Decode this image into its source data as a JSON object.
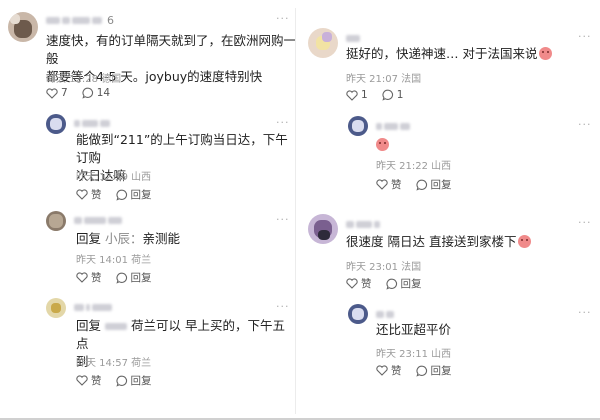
{
  "left": {
    "c1": {
      "name_tail": "6",
      "text_line1": "速度快，有的订单隔天就到了，在欧洲网购一般",
      "text_line2": "都要等个4-5 天。joybuy的速度特别快",
      "time": "昨天 12:28 德国",
      "likes": "7",
      "replies": "14"
    },
    "r1": {
      "text_line1": "能做到“211”的上午订购当日达，下午订购",
      "text_line2": "次日达嘛",
      "time": "昨天 12:59 山西",
      "like_label": "赞",
      "reply_label": "回复"
    },
    "r2": {
      "reply_prefix": "回复",
      "mention": "小辰：",
      "text": "亲测能",
      "time": "昨天 14:01 荷兰",
      "like_label": "赞",
      "reply_label": "回复"
    },
    "r3": {
      "reply_prefix": "回复",
      "text_line1": "荷兰可以 早上买的，下午五点",
      "text_line2": "到",
      "time": "昨天 14:57 荷兰",
      "like_label": "赞",
      "reply_label": "回复"
    }
  },
  "right": {
    "c1": {
      "text": "挺好的，快递神速… 对于法国来说",
      "time": "昨天 21:07 法国",
      "likes": "1",
      "replies": "1"
    },
    "r1": {
      "time": "昨天 21:22 山西",
      "like_label": "赞",
      "reply_label": "回复"
    },
    "c2": {
      "text": "很速度 隔日达 直接送到家楼下",
      "time": "昨天 23:01 法国",
      "like_label": "赞",
      "reply_label": "回复"
    },
    "r2": {
      "text": "还比亚超平价",
      "time": "昨天 23:11 山西",
      "like_label": "赞",
      "reply_label": "回复"
    }
  }
}
